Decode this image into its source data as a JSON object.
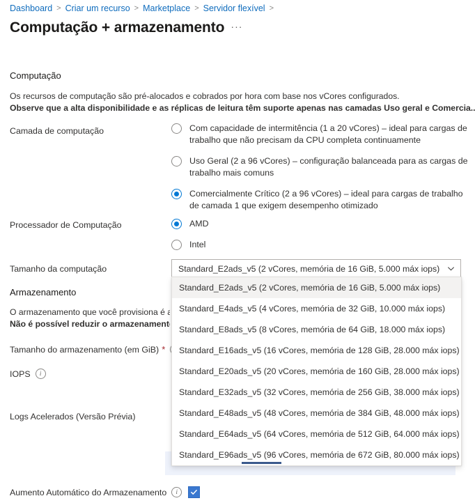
{
  "breadcrumb": {
    "items": [
      {
        "label": "Dashboard"
      },
      {
        "label": "Criar um recurso"
      },
      {
        "label": "Marketplace"
      },
      {
        "label": "Servidor flexível"
      }
    ],
    "separator": ">"
  },
  "header": {
    "title": "Computação + armazenamento",
    "more_label": "···"
  },
  "compute": {
    "section_title": "Computação",
    "description_line1": "Os recursos de computação são pré-alocados e cobrados por hora com base nos vCores configurados.",
    "description_line2": "Observe que a alta disponibilidade e as réplicas de leitura têm suporte apenas nas camadas Uso geral e Comercia...",
    "tier_label": "Camada de computação",
    "tier_options": [
      {
        "label": "Com capacidade de intermitência (1 a 20 vCores) – ideal para cargas de trabalho que não precisam da CPU completa continuamente",
        "selected": false
      },
      {
        "label": "Uso Geral (2 a 96 vCores) – configuração balanceada para as cargas de trabalho mais comuns",
        "selected": false
      },
      {
        "label": "Comercialmente Crítico (2 a 96 vCores) – ideal para cargas de trabalho de camada 1 que exigem desempenho otimizado",
        "selected": true
      }
    ],
    "processor_label": "Processador de Computação",
    "processor_options": [
      {
        "label": "AMD",
        "selected": true
      },
      {
        "label": "Intel",
        "selected": false
      }
    ],
    "size_label": "Tamanho da computação",
    "size_selected": "Standard_E2ads_v5 (2 vCores, memória de 16 GiB, 5.000 máx iops)",
    "size_options": [
      "Standard_E2ads_v5 (2 vCores, memória de 16 GiB, 5.000 máx iops)",
      "Standard_E4ads_v5 (4 vCores, memória de 32 GiB, 10.000 máx iops)",
      "Standard_E8ads_v5 (8 vCores, memória de 64 GiB, 18.000 máx iops)",
      "Standard_E16ads_v5 (16 vCores, memória de 128 GiB, 28.000 máx iops)",
      "Standard_E20ads_v5 (20 vCores, memória de 160 GiB, 28.000 máx iops)",
      "Standard_E32ads_v5 (32 vCores, memória de 256 GiB, 38.000 máx iops)",
      "Standard_E48ads_v5 (48 vCores, memória de 384 GiB, 48.000 máx iops)",
      "Standard_E64ads_v5 (64 vCores, memória de 512 GiB, 64.000 máx iops)",
      "Standard_E96ads_v5 (96 vCores, memória de 672 GiB, 80.000 máx iops)"
    ],
    "dropdown_expanded": true
  },
  "storage": {
    "section_title": "Armazenamento",
    "description_line1": "O armazenamento que você provisiona é a",
    "description_line2": "Não é possível reduzir o armazenamento",
    "size_label": "Tamanho do armazenamento (em GiB)",
    "size_required_marker": "*",
    "iops_label": "IOPS",
    "accelerated_logs_label": "Logs Acelerados (Versão Prévia)",
    "autogrow_label": "Aumento Automático do Armazenamento",
    "autogrow_checked": true
  },
  "colors": {
    "link": "#0f6cbd",
    "accent": "#0078d4",
    "checkbox": "#3a78d0",
    "required": "#a4262c",
    "tab_underline": "#3b5a8c",
    "band": "#eef2fb",
    "selected_item": "#f3f2f1"
  }
}
